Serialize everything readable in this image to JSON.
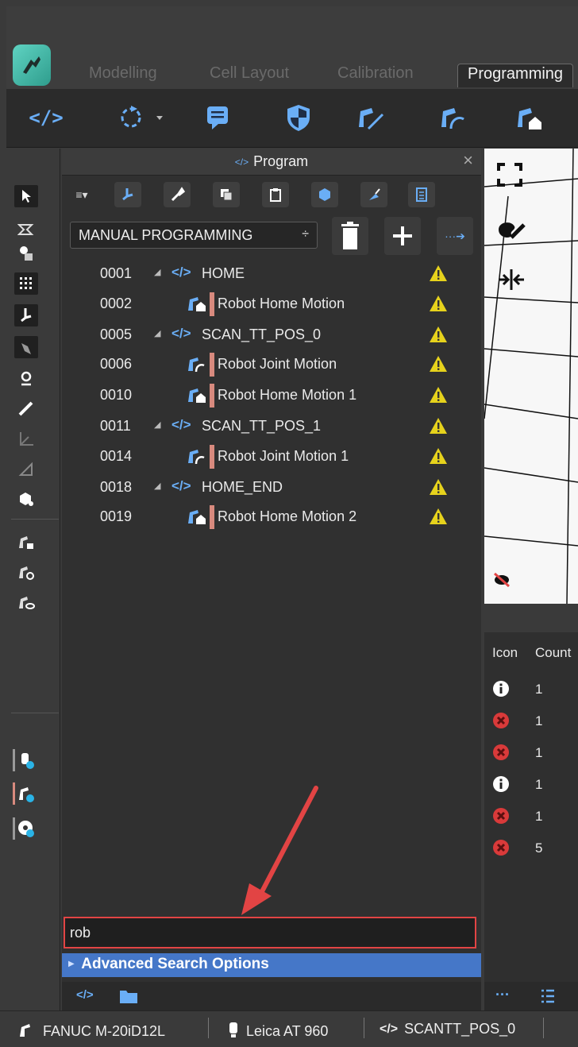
{
  "tabs": [
    "Modelling",
    "Cell Layout",
    "Calibration",
    "Programming"
  ],
  "active_tab": "Programming",
  "panel": {
    "title": "Program",
    "mode": "MANUAL PROGRAMMING",
    "rows": [
      {
        "num": "0001",
        "type": "program",
        "label": "HOME"
      },
      {
        "num": "0002",
        "type": "home",
        "label": "Robot Home Motion"
      },
      {
        "num": "0005",
        "type": "program",
        "label": "SCAN_TT_POS_0"
      },
      {
        "num": "0006",
        "type": "joint",
        "label": "Robot Joint Motion"
      },
      {
        "num": "0010",
        "type": "home",
        "label": "Robot Home Motion 1"
      },
      {
        "num": "0011",
        "type": "program",
        "label": "SCAN_TT_POS_1"
      },
      {
        "num": "0014",
        "type": "joint",
        "label": "Robot Joint Motion 1"
      },
      {
        "num": "0018",
        "type": "program",
        "label": "HOME_END"
      },
      {
        "num": "0019",
        "type": "home",
        "label": "Robot Home Motion 2"
      }
    ],
    "search_value": "rob",
    "advanced_search": "Advanced Search Options"
  },
  "messages": {
    "headers": [
      "Icon",
      "Count"
    ],
    "rows": [
      {
        "icon": "info-icon",
        "count": "1"
      },
      {
        "icon": "error-icon",
        "count": "1"
      },
      {
        "icon": "error-icon",
        "count": "1"
      },
      {
        "icon": "info-icon",
        "count": "1"
      },
      {
        "icon": "error-icon",
        "count": "1"
      },
      {
        "icon": "error-icon",
        "count": "5"
      }
    ]
  },
  "statusbar": {
    "robot": "FANUC M-20iD12L",
    "tracker": "Leica AT 960",
    "program": "SCANTT_POS_0"
  },
  "colors": {
    "accent_blue": "#4577c8",
    "highlight_red": "#e24444",
    "motion_bar": "#d88a7e",
    "code_blue": "#6aaef6"
  }
}
